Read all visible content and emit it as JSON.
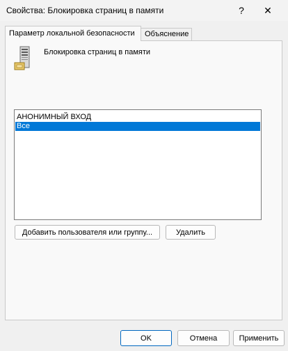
{
  "window": {
    "title": "Свойства: Блокировка страниц в памяти",
    "help_glyph": "?",
    "close_glyph": "✕"
  },
  "tabs": [
    {
      "label": "Параметр локальной безопасности",
      "active": true
    },
    {
      "label": "Объяснение",
      "active": false
    }
  ],
  "policy": {
    "name": "Блокировка страниц в памяти",
    "icon": "server-icon"
  },
  "accounts": {
    "items": [
      {
        "label": "АНОНИМНЫЙ ВХОД",
        "selected": false
      },
      {
        "label": "Все",
        "selected": true
      }
    ]
  },
  "buttons": {
    "add": "Добавить пользователя или группу...",
    "remove": "Удалить",
    "ok": "OK",
    "cancel": "Отмена",
    "apply": "Применить"
  },
  "colors": {
    "selection": "#0078d7",
    "default_button_border": "#0067c0",
    "background": "#f0f0f0"
  }
}
